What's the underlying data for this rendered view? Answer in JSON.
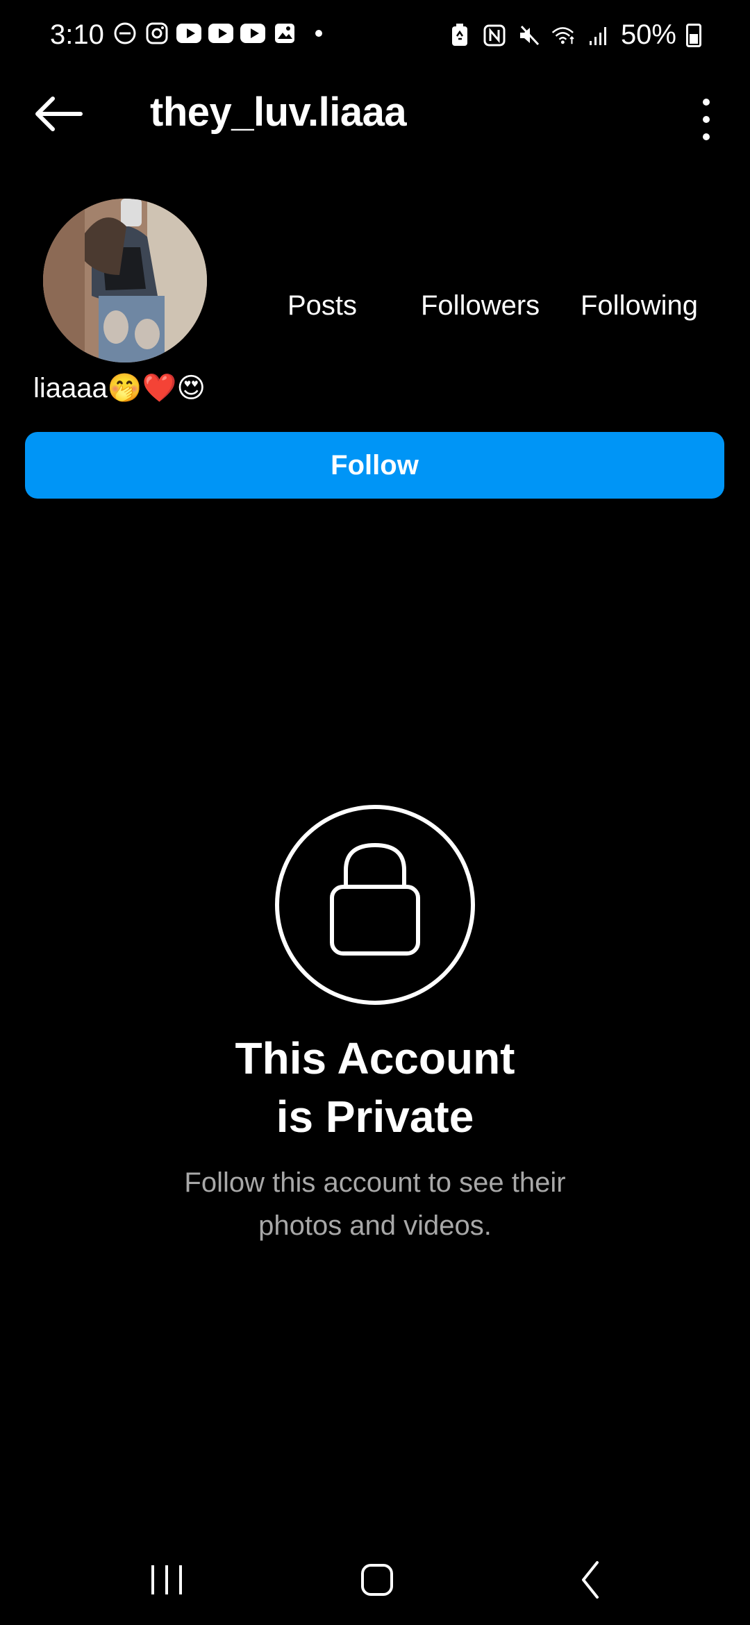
{
  "status_bar": {
    "time": "3:10",
    "battery": "50%",
    "left_icons": [
      "dnd-icon",
      "instagram-icon",
      "youtube-icon",
      "youtube-icon",
      "youtube-icon",
      "gallery-icon",
      "notification-dot"
    ],
    "right_icons": [
      "battery-saver-icon",
      "nfc-icon",
      "mute-icon",
      "wifi-icon",
      "signal-icon",
      "battery-icon"
    ]
  },
  "header": {
    "username": "they_luv.liaaa"
  },
  "profile": {
    "stats": {
      "posts_label": "Posts",
      "followers_label": "Followers",
      "following_label": "Following"
    },
    "bio": "liaaaa🤭❤️😍",
    "follow_label": "Follow"
  },
  "private_notice": {
    "title_line1": "This Account",
    "title_line2": "is Private",
    "subtitle_line1": "Follow this account to see their",
    "subtitle_line2": "photos and videos."
  },
  "colors": {
    "background": "#000000",
    "accent": "#0095f6",
    "secondary_text": "#a8a8a8"
  }
}
